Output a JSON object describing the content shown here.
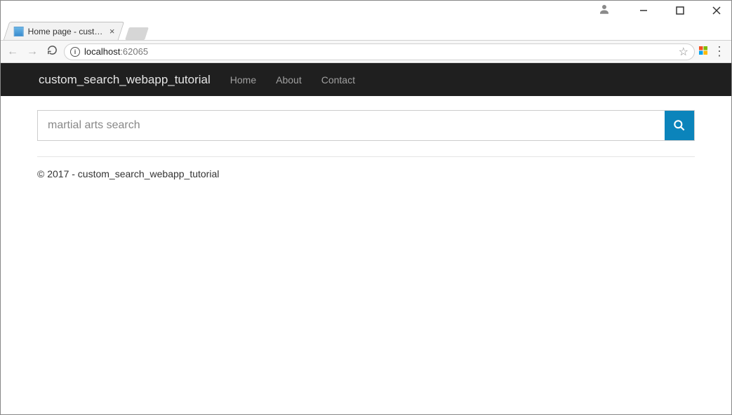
{
  "window": {
    "tab_title": "Home page - custom_se..."
  },
  "address_bar": {
    "host": "localhost",
    "port": ":62065"
  },
  "navbar": {
    "brand": "custom_search_webapp_tutorial",
    "links": [
      {
        "label": "Home"
      },
      {
        "label": "About"
      },
      {
        "label": "Contact"
      }
    ]
  },
  "search": {
    "placeholder": "martial arts search"
  },
  "footer": {
    "text": "© 2017 - custom_search_webapp_tutorial"
  }
}
